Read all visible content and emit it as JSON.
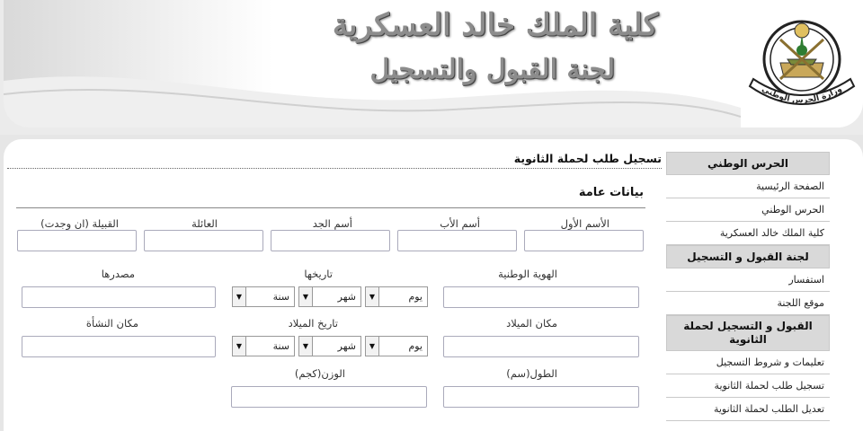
{
  "header": {
    "title_line1": "كلية الملك خالد العسكرية",
    "title_line2": "لجنة القبول والتسجيل",
    "emblem_text": "وزارة الحرس الوطني"
  },
  "sidebar": {
    "sections": [
      {
        "heading": "الحرس الوطني",
        "items": [
          "الصفحة الرئيسية",
          "الحرس الوطني",
          "كلية الملك خالد العسكرية"
        ]
      },
      {
        "heading": "لجنة القبول و التسجيل",
        "items": [
          "استفسار",
          "موقع اللجنة"
        ]
      },
      {
        "heading": "القبول و التسجيل لحملة الثانوية",
        "items": [
          "تعليمات و شروط التسجيل",
          "تسجيل طلب لحملة الثانوية",
          "تعديل الطلب لحملة الثانوية"
        ]
      }
    ]
  },
  "main": {
    "page_title": "تسجيل طلب لحملة الثانوية",
    "section_title": "بيانات عامة",
    "labels": {
      "first_name": "الأسم الأول",
      "father_name": "أسم الأب",
      "grandfather_name": "أسم الجد",
      "family": "العائلة",
      "tribe": "القبيلة (ان وجدت)",
      "national_id": "الهوية الوطنية",
      "id_date": "تاريخها",
      "id_source": "مصدرها",
      "birth_place": "مكان الميلاد",
      "birth_date": "تاريخ الميلاد",
      "origin_place": "مكان النشأة",
      "height": "الطول(سم)",
      "weight": "الوزن(كجم)"
    },
    "date_selects": {
      "day": "يوم",
      "month": "شهر",
      "year": "سنة"
    }
  }
}
